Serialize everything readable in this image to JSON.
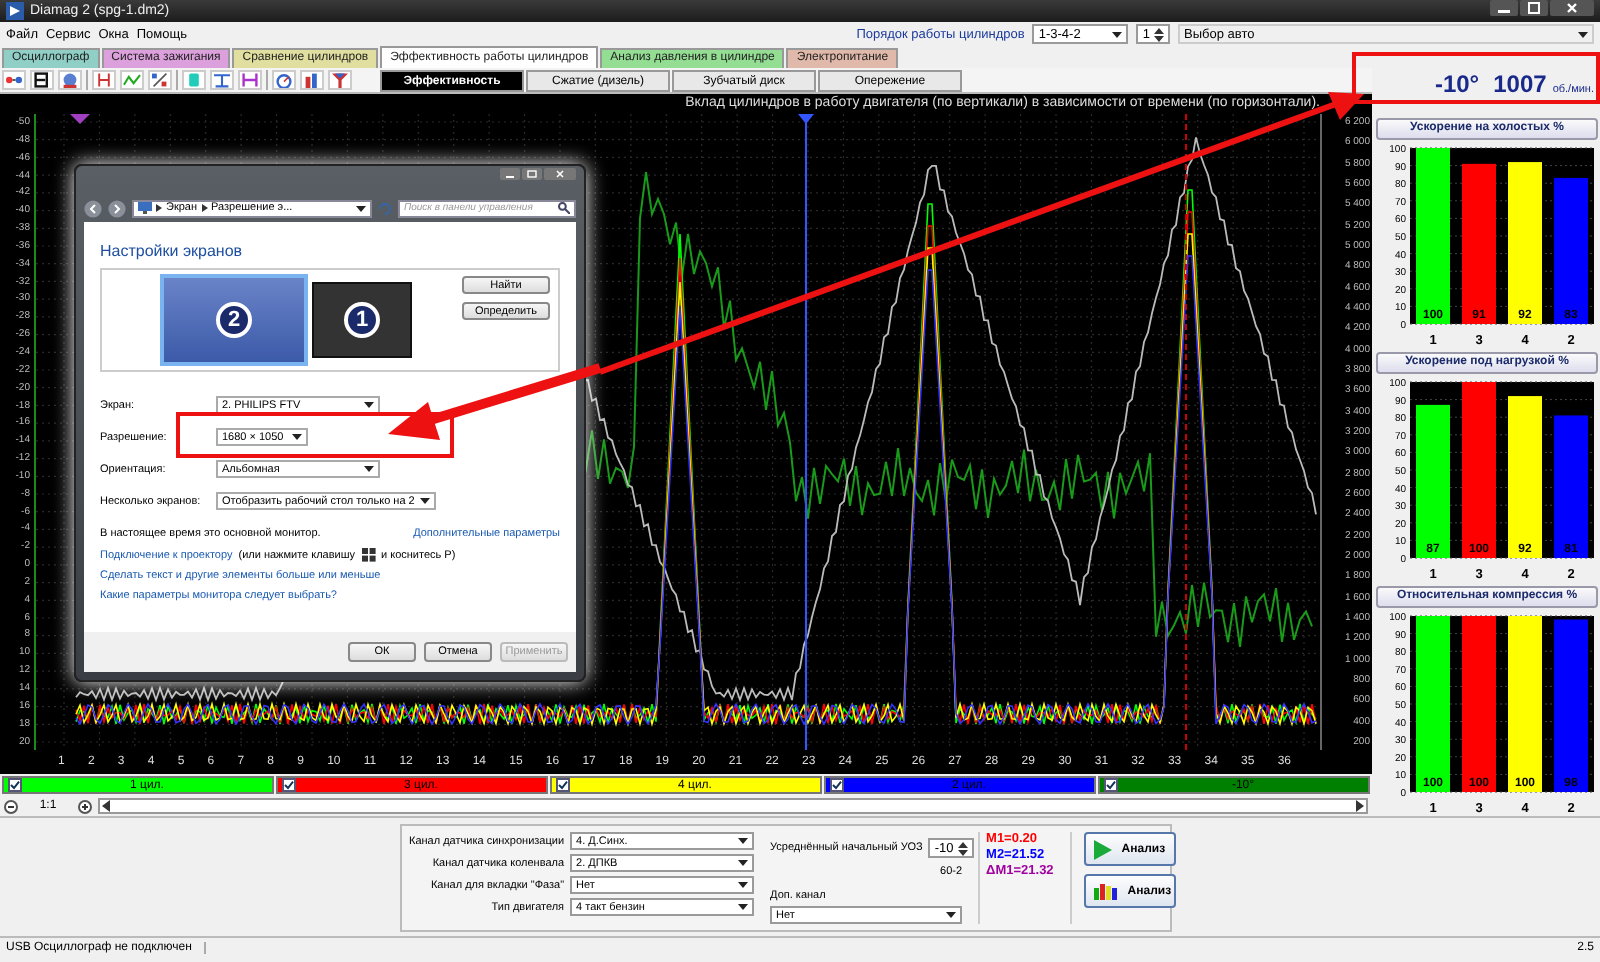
{
  "window": {
    "title": "Diamag 2 (spg-1.dm2)"
  },
  "menu": [
    "Файл",
    "Сервис",
    "Окна",
    "Помощь"
  ],
  "cylinder_order": {
    "label": "Порядок работы цилиндров",
    "value": "1-3-4-2",
    "spin": "1"
  },
  "car_select": {
    "value": "Выбор авто"
  },
  "tabs": [
    {
      "label": "Осциллограф",
      "color": "#8fcfc6",
      "selected": false
    },
    {
      "label": "Система зажигания",
      "color": "#dca0dc",
      "selected": false
    },
    {
      "label": "Сравнение цилиндров",
      "color": "#e0dfa0",
      "selected": false
    },
    {
      "label": "Эффективность работы цилиндров",
      "color": "#ffffff",
      "selected": true
    },
    {
      "label": "Анализ давления в цилиндре",
      "color": "#94de94",
      "selected": false
    },
    {
      "label": "Электропитание",
      "color": "#e0b9aa",
      "selected": false
    }
  ],
  "subtabs": [
    {
      "label": "Эффективность",
      "selected": true
    },
    {
      "label": "Сжатие (дизель)",
      "selected": false
    },
    {
      "label": "Зубчатый диск",
      "selected": false
    },
    {
      "label": "Опережение",
      "selected": false
    }
  ],
  "chart_title": "Вклад цилиндров в работу двигателя (по вертикали) в зависимости от времени (по горизонтали).",
  "oscillogram": {
    "y_left_labels": [
      "-50",
      "-48",
      "-46",
      "-44",
      "-42",
      "-40",
      "-38",
      "-36",
      "-34",
      "-32",
      "-30",
      "-28",
      "-26",
      "-24",
      "-22",
      "-20",
      "-18",
      "-16",
      "-14",
      "-12",
      "-10",
      "-8",
      "-6",
      "-4",
      "-2",
      "0",
      "2",
      "4",
      "6",
      "8",
      "10",
      "12",
      "14",
      "16",
      "18",
      "20"
    ],
    "y_right_labels": [
      "6 200",
      "6 000",
      "5 800",
      "5 600",
      "5 400",
      "5 200",
      "5 000",
      "4 800",
      "4 600",
      "4 400",
      "4 200",
      "4 000",
      "3 800",
      "3 600",
      "3 400",
      "3 200",
      "3 000",
      "2 800",
      "2 600",
      "2 400",
      "2 200",
      "2 000",
      "1 800",
      "1 600",
      "1 400",
      "1 200",
      "1 000",
      "800",
      "600",
      "400",
      "200"
    ],
    "x_labels": [
      "1",
      "2",
      "3",
      "4",
      "5",
      "6",
      "7",
      "8",
      "9",
      "10",
      "11",
      "12",
      "13",
      "14",
      "15",
      "16",
      "17",
      "18",
      "19",
      "20",
      "21",
      "22",
      "23",
      "24",
      "25",
      "26",
      "27",
      "28",
      "29",
      "30",
      "31",
      "32",
      "33",
      "34",
      "35",
      "36"
    ]
  },
  "readout": {
    "angle": "-10°",
    "rpm": "1007",
    "unit": "об./мин."
  },
  "bar_panels": [
    {
      "title": "Ускорение на холостых %",
      "chart_data": {
        "type": "bar",
        "categories": [
          "1",
          "3",
          "4",
          "2"
        ],
        "stacked": true,
        "grid": true,
        "ylim": [
          0,
          100
        ],
        "yticks": [
          0,
          10,
          20,
          30,
          40,
          50,
          60,
          70,
          80,
          90,
          100
        ],
        "data_labels": true,
        "series": [
          {
            "color": "#00ff00",
            "values": [
              100,
              null,
              null,
              null
            ]
          },
          {
            "color": "#ff0000",
            "values": [
              null,
              91,
              null,
              null
            ]
          },
          {
            "color": "#ffff00",
            "values": [
              null,
              null,
              92,
              null
            ]
          },
          {
            "color": "#0000ff",
            "values": [
              null,
              null,
              null,
              83
            ]
          }
        ]
      }
    },
    {
      "title": "Ускорение под нагрузкой %",
      "chart_data": {
        "type": "bar",
        "categories": [
          "1",
          "3",
          "4",
          "2"
        ],
        "stacked": true,
        "grid": true,
        "ylim": [
          0,
          100
        ],
        "yticks": [
          0,
          10,
          20,
          30,
          40,
          50,
          60,
          70,
          80,
          90,
          100
        ],
        "data_labels": true,
        "series": [
          {
            "color": "#00ff00",
            "values": [
              87,
              null,
              null,
              null
            ]
          },
          {
            "color": "#ff0000",
            "values": [
              null,
              100,
              null,
              null
            ]
          },
          {
            "color": "#ffff00",
            "values": [
              null,
              null,
              92,
              null
            ]
          },
          {
            "color": "#0000ff",
            "values": [
              null,
              null,
              null,
              81
            ]
          }
        ]
      }
    },
    {
      "title": "Относительная компрессия %",
      "chart_data": {
        "type": "bar",
        "categories": [
          "1",
          "3",
          "4",
          "2"
        ],
        "stacked": true,
        "grid": true,
        "ylim": [
          0,
          100
        ],
        "yticks": [
          0,
          10,
          20,
          30,
          40,
          50,
          60,
          70,
          80,
          90,
          100
        ],
        "data_labels": true,
        "series": [
          {
            "color": "#00ff00",
            "values": [
              100,
              null,
              null,
              null
            ]
          },
          {
            "color": "#ff0000",
            "values": [
              null,
              100,
              null,
              null
            ]
          },
          {
            "color": "#ffff00",
            "values": [
              null,
              null,
              100,
              null
            ]
          },
          {
            "color": "#0000ff",
            "values": [
              null,
              null,
              null,
              98
            ]
          }
        ]
      }
    }
  ],
  "cylinders": [
    {
      "label": "1 цил.",
      "color": "#00ff00",
      "checked": true
    },
    {
      "label": "3 цил.",
      "color": "#ff0000",
      "checked": true
    },
    {
      "label": "4 цил.",
      "color": "#ffff00",
      "checked": true
    },
    {
      "label": "2 цил.",
      "color": "#0000ff",
      "checked": true
    },
    {
      "label": "-10°",
      "color": "#008000",
      "checked": true
    }
  ],
  "zoom": {
    "value": "1:1"
  },
  "settings": {
    "channels": [
      {
        "label": "Канал датчика синхронизации",
        "value": "4. Д.Синх."
      },
      {
        "label": "Канал датчика коленвала",
        "value": "2. ДПКВ"
      },
      {
        "label": "Канал для вкладки \"Фаза\"",
        "value": "Нет"
      },
      {
        "label": "Тип двигателя",
        "value": "4 такт бензин"
      }
    ],
    "uoz": {
      "label": "Усреднённый начальный УОЗ",
      "value": "-10"
    },
    "crank_pattern": "60-2",
    "extra_channel": {
      "label": "Доп. канал",
      "value": "Нет"
    },
    "markers": [
      {
        "text": "M1=0.20",
        "color": "#ff0000"
      },
      {
        "text": "M2=21.52",
        "color": "#0000ff"
      },
      {
        "text": "ΔM1=21.32",
        "color": "#a000a0"
      }
    ],
    "buttons": [
      {
        "label": "Анализ",
        "kind": "play"
      },
      {
        "label": "Анализ",
        "kind": "bars"
      }
    ]
  },
  "dialog": {
    "breadcrumb": [
      "Экран",
      "Разрешение э..."
    ],
    "search": {
      "placeholder": "Поиск в панели управления"
    },
    "heading": "Настройки экранов",
    "monitors": [
      {
        "label": "2",
        "selected": true
      },
      {
        "label": "1",
        "selected": false
      }
    ],
    "side_buttons": [
      "Найти",
      "Определить"
    ],
    "fields": [
      {
        "label": "Экран:",
        "value": "2. PHILIPS FTV"
      },
      {
        "label": "Разрешение:",
        "value": "1680 × 1050"
      },
      {
        "label": "Ориентация:",
        "value": "Альбомная"
      },
      {
        "label": "Несколько экранов:",
        "value": "Отобразить рабочий стол только на 2"
      }
    ],
    "status_text": "В настоящее время это основной монитор.",
    "advanced_link": "Дополнительные параметры",
    "projector": {
      "link": "Подключение к проектору",
      "before_key": "(или нажмите клавишу",
      "after_key": "и коснитесь P)"
    },
    "links": [
      "Сделать текст и другие элементы больше или меньше",
      "Какие параметры монитора следует выбрать?"
    ],
    "buttons": [
      {
        "label": "ОК",
        "disabled": false
      },
      {
        "label": "Отмена",
        "disabled": false
      },
      {
        "label": "Применить",
        "disabled": true
      }
    ]
  },
  "status_bar": {
    "message": "USB Осциллограф не подключен",
    "version": "2.5"
  }
}
